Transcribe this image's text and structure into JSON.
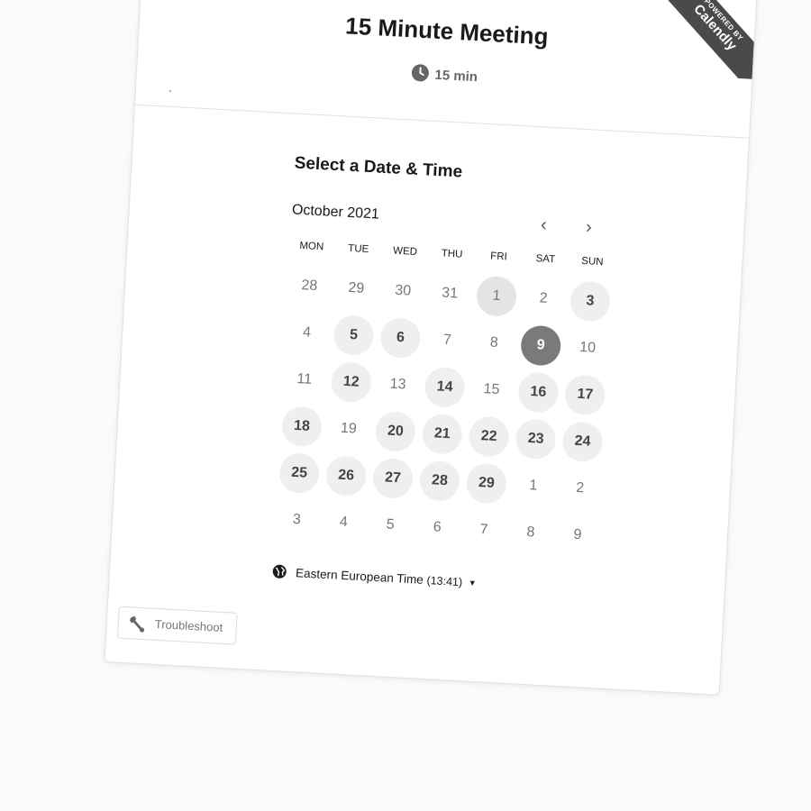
{
  "event": {
    "title": "15 Minute Meeting",
    "duration": "15 min",
    "description": "."
  },
  "branding": {
    "powered_by": "POWERED BY",
    "brand": "Calendly"
  },
  "scheduler": {
    "heading": "Select a Date & Time",
    "month": "October 2021",
    "prev_icon": "chevron-left-icon",
    "next_icon": "chevron-right-icon",
    "weekdays": [
      "MON",
      "TUE",
      "WED",
      "THU",
      "FRI",
      "SAT",
      "SUN"
    ],
    "weeks": [
      [
        {
          "label": "28",
          "state": "outside"
        },
        {
          "label": "29",
          "state": "outside"
        },
        {
          "label": "30",
          "state": "outside"
        },
        {
          "label": "31",
          "state": "outside"
        },
        {
          "label": "1",
          "state": "today"
        },
        {
          "label": "2",
          "state": "unavailable"
        },
        {
          "label": "3",
          "state": "available"
        }
      ],
      [
        {
          "label": "4",
          "state": "unavailable"
        },
        {
          "label": "5",
          "state": "available"
        },
        {
          "label": "6",
          "state": "available"
        },
        {
          "label": "7",
          "state": "unavailable"
        },
        {
          "label": "8",
          "state": "unavailable"
        },
        {
          "label": "9",
          "state": "selected"
        },
        {
          "label": "10",
          "state": "unavailable"
        }
      ],
      [
        {
          "label": "11",
          "state": "unavailable"
        },
        {
          "label": "12",
          "state": "available"
        },
        {
          "label": "13",
          "state": "unavailable"
        },
        {
          "label": "14",
          "state": "available"
        },
        {
          "label": "15",
          "state": "unavailable"
        },
        {
          "label": "16",
          "state": "available"
        },
        {
          "label": "17",
          "state": "available"
        }
      ],
      [
        {
          "label": "18",
          "state": "available"
        },
        {
          "label": "19",
          "state": "unavailable"
        },
        {
          "label": "20",
          "state": "available"
        },
        {
          "label": "21",
          "state": "available"
        },
        {
          "label": "22",
          "state": "available"
        },
        {
          "label": "23",
          "state": "available"
        },
        {
          "label": "24",
          "state": "available"
        }
      ],
      [
        {
          "label": "25",
          "state": "available"
        },
        {
          "label": "26",
          "state": "available"
        },
        {
          "label": "27",
          "state": "available"
        },
        {
          "label": "28",
          "state": "available"
        },
        {
          "label": "29",
          "state": "available"
        },
        {
          "label": "1",
          "state": "outside"
        },
        {
          "label": "2",
          "state": "outside"
        }
      ],
      [
        {
          "label": "3",
          "state": "outside"
        },
        {
          "label": "4",
          "state": "outside"
        },
        {
          "label": "5",
          "state": "outside"
        },
        {
          "label": "6",
          "state": "outside"
        },
        {
          "label": "7",
          "state": "outside"
        },
        {
          "label": "8",
          "state": "outside"
        },
        {
          "label": "9",
          "state": "outside"
        }
      ]
    ]
  },
  "timezone": {
    "name": "Eastern European Time",
    "time": "(13:41)",
    "icon": "globe-icon"
  },
  "troubleshoot": {
    "label": "Troubleshoot",
    "icon": "wrench-icon"
  },
  "colors": {
    "selected": "#7a7a7a",
    "available": "#efefef",
    "ribbon": "#4a4a4a"
  }
}
